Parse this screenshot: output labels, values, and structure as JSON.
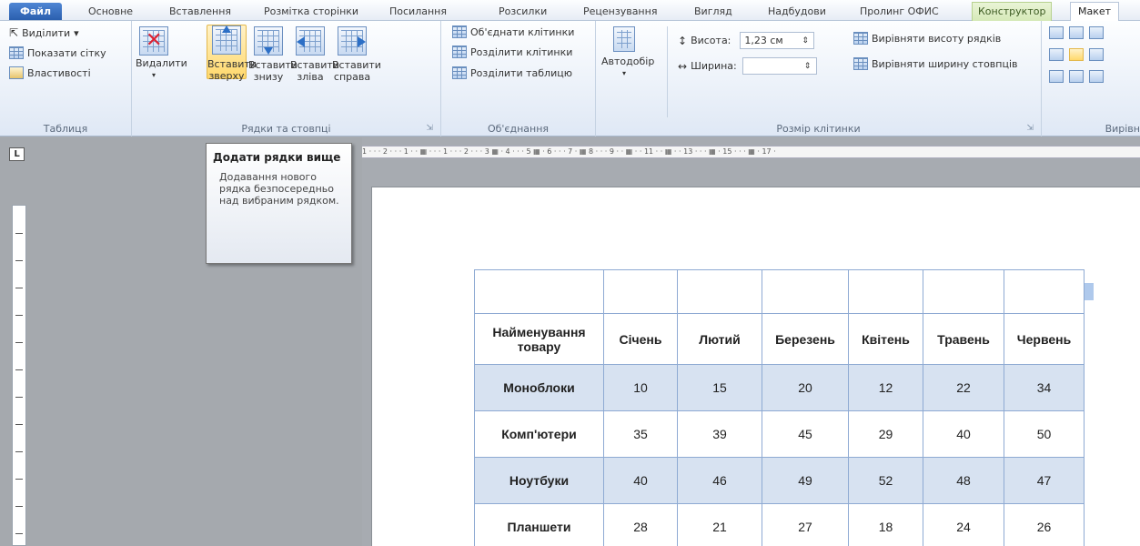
{
  "tabs": [
    "Файл",
    "Основне",
    "Вставлення",
    "Розмітка сторінки",
    "Посилання",
    "Розсилки",
    "Рецензування",
    "Вигляд",
    "Надбудови",
    "Пролинг ОФИС",
    "Конструктор",
    "Макет"
  ],
  "ribbon": {
    "table_group": {
      "select": "Виділити",
      "gridlines": "Показати сітку",
      "properties": "Властивості",
      "label": "Таблиця"
    },
    "rows_cols": {
      "delete": "Видалити",
      "insert_above": "Вставити зверху",
      "insert_below": "Вставити знизу",
      "insert_left": "Вставити зліва",
      "insert_right": "Вставити справа",
      "label": "Рядки та стовпці"
    },
    "merge": {
      "merge_cells": "Об'єднати клітинки",
      "split_cells": "Розділити клітинки",
      "split_table": "Розділити таблицю",
      "label": "Об'єднання"
    },
    "autofit": "Автодобір",
    "cell_size": {
      "height_label": "Висота:",
      "height_value": "1,23 см",
      "width_label": "Ширина:",
      "width_value": "",
      "dist_rows": "Вирівняти висоту рядків",
      "dist_cols": "Вирівняти ширину стовпців",
      "label": "Розмір клітинки"
    },
    "align_label": "Вирівн"
  },
  "tooltip": {
    "title": "Додати рядки вище",
    "body": "Додавання нового рядка безпосередньо над вибраним рядком."
  },
  "ruler": {
    "corner": "L",
    "marks": "1 · · · 2 · · · 1 · · ▦ · · · 1 · · · 2 · · · 3 ▦ · 4 · · · 5 ▦ · 6 · · · 7 · ▦ 8 · · · 9 · · ▦ · · 11 · · ▦ · · 13 · · · ▦ · 15 · · · ▦ · 17 ·"
  },
  "table": {
    "header": [
      "Найменування товару",
      "Січень",
      "Лютий",
      "Березень",
      "Квітень",
      "Травень",
      "Червень"
    ],
    "rows": [
      [
        "Моноблоки",
        "10",
        "15",
        "20",
        "12",
        "22",
        "34"
      ],
      [
        "Комп'ютери",
        "35",
        "39",
        "45",
        "29",
        "40",
        "50"
      ],
      [
        "Ноутбуки",
        "40",
        "46",
        "49",
        "52",
        "48",
        "47"
      ],
      [
        "Планшети",
        "28",
        "21",
        "27",
        "18",
        "24",
        "26"
      ]
    ]
  }
}
